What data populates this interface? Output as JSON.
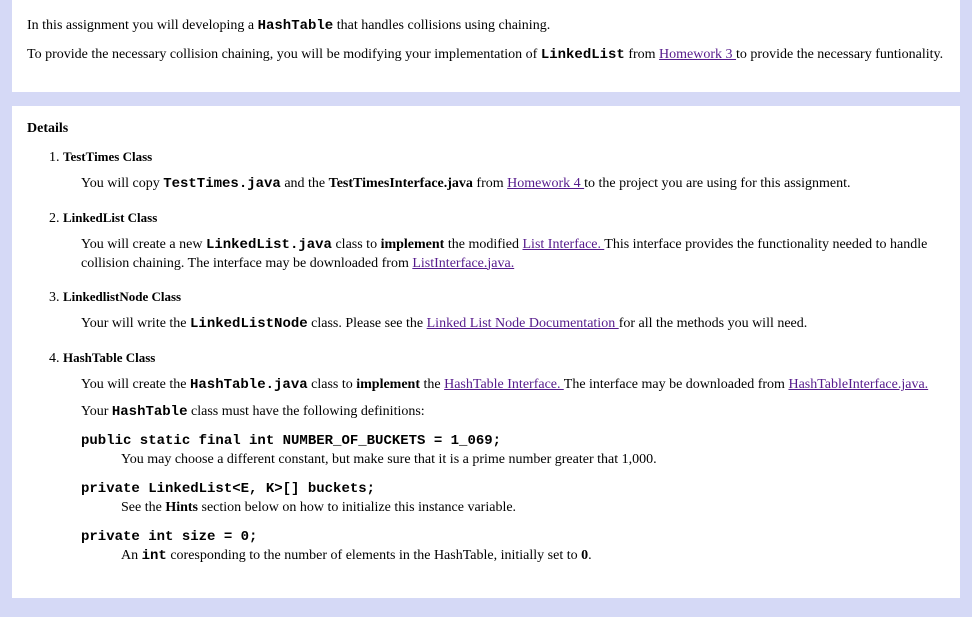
{
  "intro": {
    "p1_pre": "In this assignment you will developing a ",
    "p1_code": "HashTable",
    "p1_post": " that handles collisions using chaining.",
    "p2_pre": "To provide the necessary collision chaining, you will be modifying your implementation of ",
    "p2_code": "LinkedList",
    "p2_mid": " from ",
    "p2_link": "Homework 3 ",
    "p2_post": " to provide the necessary funtionality."
  },
  "details": {
    "heading": "Details",
    "items": {
      "i1": {
        "title": "TestTimes Class",
        "text_pre": "You will copy ",
        "code1": "TestTimes.java",
        "text_mid1": " and the ",
        "bold1": "TestTimesInterface.java",
        "text_mid2": " from ",
        "link": "Homework 4 ",
        "text_post": "to the project you are using for this assignment."
      },
      "i2": {
        "title": "LinkedList Class",
        "text_pre": "You will create a new ",
        "code1": "LinkedList.java",
        "text_mid1": " class to ",
        "bold1": "implement",
        "text_mid2": " the modified ",
        "link1": "List Interface. ",
        "text_mid3": "This interface provides the functionality needed to handle collision chaining. The interface may be downloaded from ",
        "link2": "ListInterface.java."
      },
      "i3": {
        "title": "LinkedlistNode Class",
        "text_pre": "Your will write the ",
        "code1": "LinkedListNode",
        "text_mid1": " class. Please see the ",
        "link": "Linked List Node Documentation ",
        "text_post": "for all the methods you will need."
      },
      "i4": {
        "title": "HashTable Class",
        "p1_pre": "You will create the ",
        "p1_code": "HashTable.java",
        "p1_mid1": " class to ",
        "p1_bold": "implement",
        "p1_mid2": " the ",
        "p1_link1": "HashTable Interface. ",
        "p1_mid3": "The interface may be downloaded from ",
        "p1_link2": "HashTableInterface.java.",
        "p2_pre": "Your ",
        "p2_code": "HashTable",
        "p2_post": " class must have the following definitions:",
        "def1_line": "public static final int NUMBER_OF_BUCKETS = 1_069;",
        "def1_desc": "You may choose a different constant, but make sure that it is a prime number greater that 1,000.",
        "def2_line": "private LinkedList<E, K>[] buckets;",
        "def2_desc_pre": "See the ",
        "def2_desc_bold": "Hints",
        "def2_desc_post": " section below on how to initialize this instance variable.",
        "def3_line": "private int size = 0;",
        "def3_desc_pre": "An ",
        "def3_desc_code": "int",
        "def3_desc_mid": " coresponding to the number of elements in the HashTable, initially set to ",
        "def3_desc_bold": "0",
        "def3_desc_post": "."
      }
    }
  }
}
